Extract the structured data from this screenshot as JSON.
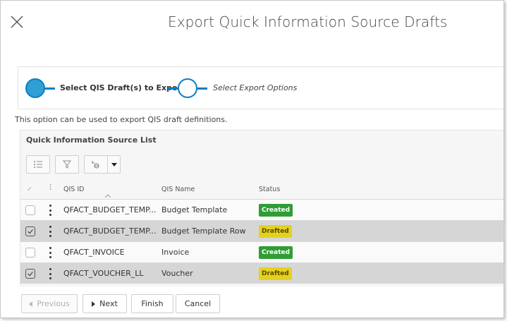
{
  "dialog": {
    "title": "Export Quick Information Source Drafts",
    "close_icon": "close-icon"
  },
  "wizard": {
    "steps": [
      {
        "label": "Select QIS Draft(s) to Export",
        "state": "active"
      },
      {
        "label": "Select Export Options",
        "state": "inactive"
      }
    ],
    "accent_color": "#0b7ec1"
  },
  "description": "This option can be used to export QIS draft definitions.",
  "list": {
    "title": "Quick Information Source List",
    "toolbar": {
      "list_icon": "list-settings-icon",
      "filter_icon": "filter-icon",
      "group_icon": "group-by-icon",
      "dropdown_icon": "caret-down-icon"
    },
    "columns": {
      "select": "✓",
      "id": "QIS ID",
      "name": "QIS Name",
      "status": "Status"
    },
    "rows": [
      {
        "id": "QFACT_BUDGET_TEMP...",
        "name": "Budget Template",
        "status": "Created",
        "status_color": "#2e9e34",
        "selected": false
      },
      {
        "id": "QFACT_BUDGET_TEMP...",
        "name": "Budget Template Row",
        "status": "Drafted",
        "status_color": "#e4d11f",
        "selected": true
      },
      {
        "id": "QFACT_INVOICE",
        "name": "Invoice",
        "status": "Created",
        "status_color": "#2e9e34",
        "selected": false
      },
      {
        "id": "QFACT_VOUCHER_LL",
        "name": "Voucher",
        "status": "Drafted",
        "status_color": "#e4d11f",
        "selected": true
      }
    ]
  },
  "footer": {
    "previous": "Previous",
    "next": "Next",
    "finish": "Finish",
    "cancel": "Cancel"
  }
}
